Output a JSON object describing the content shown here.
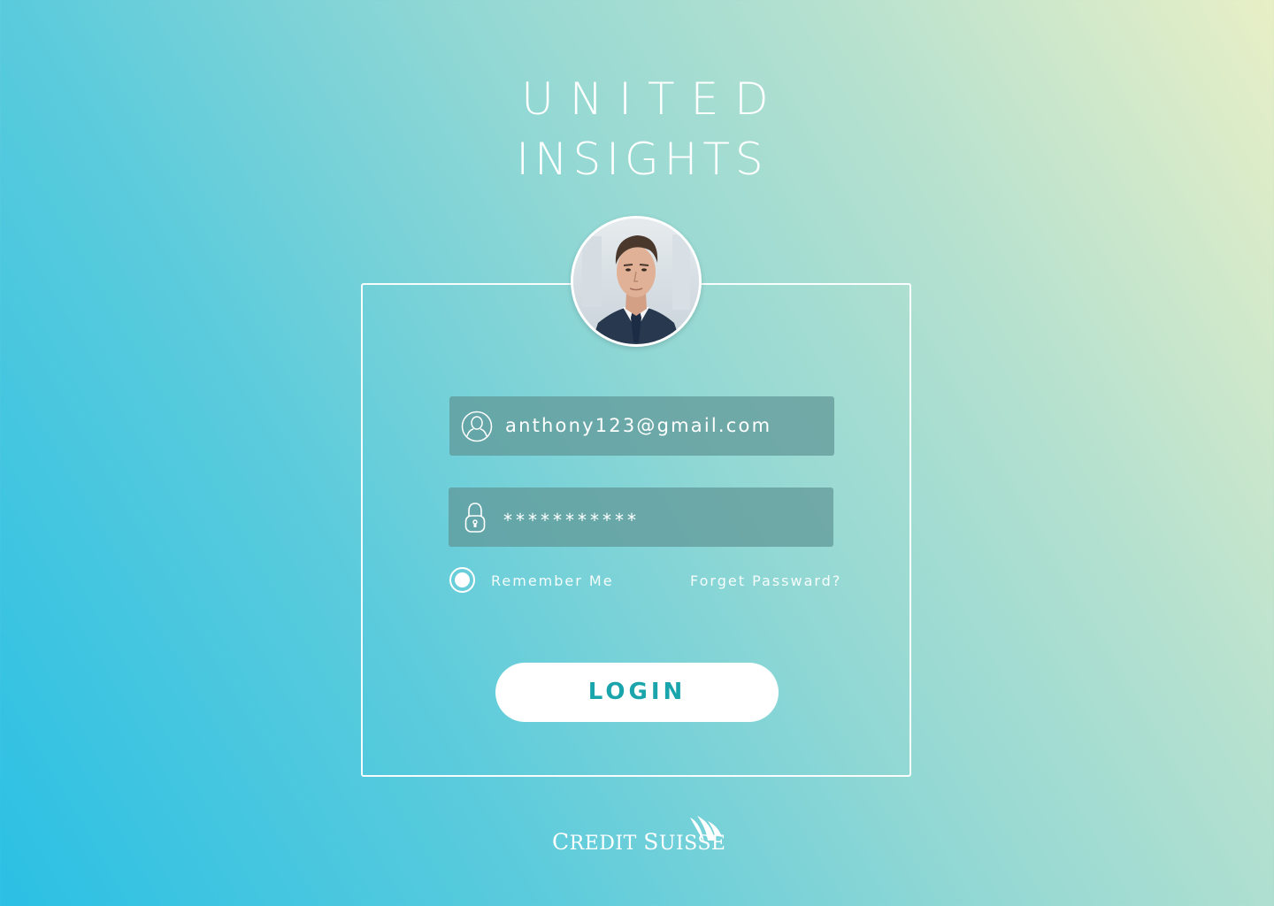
{
  "app": {
    "title_line_1": "UNITED",
    "title_line_2": "INSIGHTS"
  },
  "profile": {
    "avatar_icon": "user-photo-avatar"
  },
  "form": {
    "email": {
      "icon": "user-icon",
      "value": "anthony123@gmail.com"
    },
    "password": {
      "icon": "lock-icon",
      "value": "***********"
    },
    "remember": {
      "label": "Remember Me",
      "checked": true
    },
    "forgot_label": "Forget Passward?",
    "login_label": "LOGIN"
  },
  "footer": {
    "logo_text_c": "C",
    "logo_text_redit": "REDIT",
    "logo_text_s": "S",
    "logo_text_uisse": "UISSE",
    "logo_icon": "sails-logo-icon"
  },
  "colors": {
    "accent": "#1aa4ac",
    "gradient_start": "#2bc0e4",
    "gradient_end": "#e8efc6"
  }
}
